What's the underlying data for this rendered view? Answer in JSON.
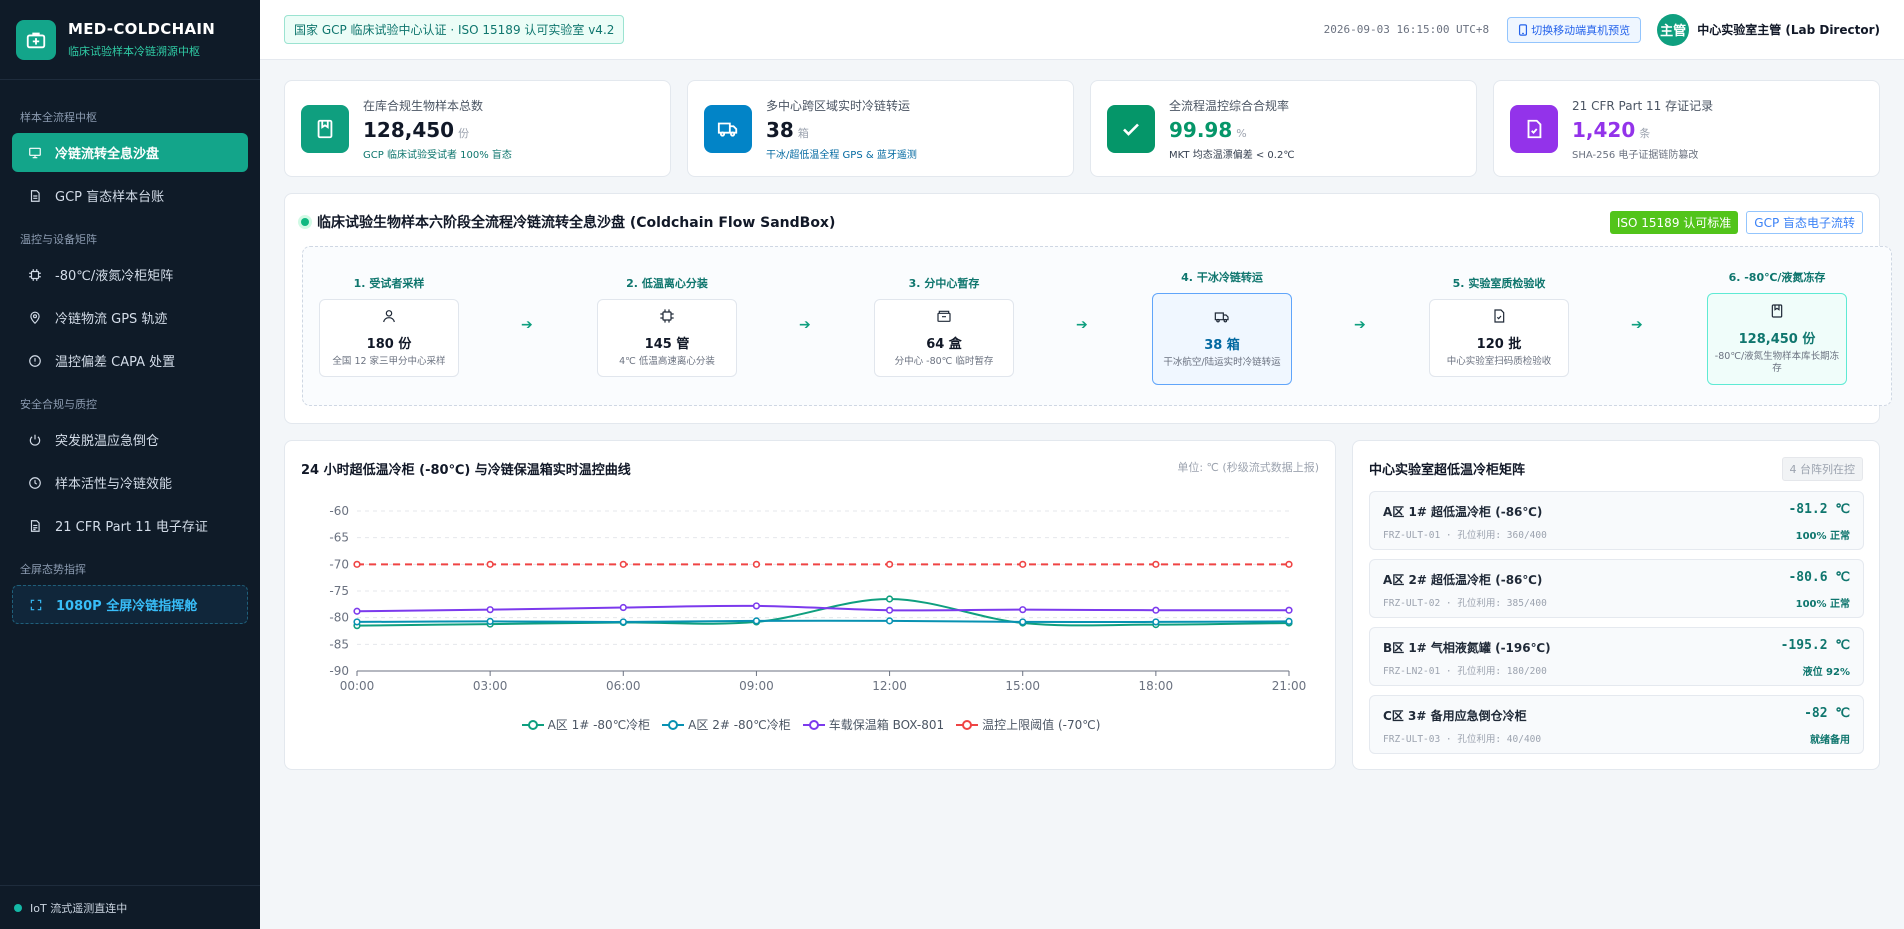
{
  "brand": {
    "title": "MED-COLDCHAIN",
    "subtitle": "临床试验样本冷链溯源中枢"
  },
  "sidebar": {
    "groups": [
      {
        "title": "样本全流程中枢",
        "items": [
          {
            "label": "冷链流转全息沙盘",
            "icon": "monitor-icon",
            "active": true
          },
          {
            "label": "GCP 盲态样本台账",
            "icon": "document-icon"
          }
        ]
      },
      {
        "title": "温控与设备矩阵",
        "items": [
          {
            "label": "-80℃/液氮冷柜矩阵",
            "icon": "chip-icon"
          },
          {
            "label": "冷链物流 GPS 轨迹",
            "icon": "location-pin-icon"
          },
          {
            "label": "温控偏差 CAPA 处置",
            "icon": "alert-circle-icon"
          }
        ]
      },
      {
        "title": "安全合规与质控",
        "items": [
          {
            "label": "突发脱温应急倒仓",
            "icon": "power-icon"
          },
          {
            "label": "样本活性与冷链效能",
            "icon": "clock-icon"
          },
          {
            "label": "21 CFR Part 11 电子存证",
            "icon": "file-text-icon"
          }
        ]
      },
      {
        "title": "全屏态势指挥",
        "items": [
          {
            "label": "1080P 全屏冷链指挥舱",
            "icon": "fullscreen-icon"
          }
        ]
      }
    ],
    "footer": "IoT 流式遥测直连中"
  },
  "header": {
    "cert": "国家 GCP 临床试验中心认证 · ISO 15189 认可实验室 v4.2",
    "timestamp": "2026-09-03 16:15:00 UTC+8",
    "preview_button": "切换移动端真机预览",
    "avatar": "主管",
    "user": "中心实验室主管 (Lab Director)"
  },
  "kpis": [
    {
      "label": "在库合规生物样本总数",
      "value": "128,450",
      "unit": "份",
      "note": "GCP 临床试验受试者 100% 盲态",
      "icon": "storage-box-icon",
      "color": "#0f9f7f",
      "value_color": "#111827",
      "note_color": "#0f766e"
    },
    {
      "label": "多中心跨区域实时冷链转运",
      "value": "38",
      "unit": "箱",
      "note": "干冰/超低温全程 GPS & 蓝牙遥测",
      "icon": "truck-icon",
      "color": "#0284c7",
      "value_color": "#111827",
      "note_color": "#0369a1"
    },
    {
      "label": "全流程温控综合合规率",
      "value": "99.98",
      "unit": "%",
      "note": "MKT 均态温漂偏差 < 0.2℃",
      "icon": "check-icon",
      "color": "#059669",
      "value_color": "#059669",
      "note_color": "#374151"
    },
    {
      "label": "21 CFR Part 11 存证记录",
      "value": "1,420",
      "unit": "条",
      "note": "SHA-256 电子证据链防篡改",
      "icon": "file-check-icon",
      "color": "#9333ea",
      "value_color": "#9333ea",
      "note_color": "#6b7280"
    }
  ],
  "flow": {
    "title": "临床试验生物样本六阶段全流程冷链流转全息沙盘 (Coldchain Flow SandBox)",
    "tag_primary": "ISO 15189 认可标准",
    "tag_secondary": "GCP 盲态电子流转",
    "stages": [
      {
        "label": "1. 受试者采样",
        "value": "180 份",
        "desc": "全国 12 家三甲分中心采样",
        "icon": "user-icon"
      },
      {
        "label": "2. 低温离心分装",
        "value": "145 管",
        "desc": "4℃ 低温高速离心分装",
        "icon": "chip-icon"
      },
      {
        "label": "3. 分中心暂存",
        "value": "64 盒",
        "desc": "分中心 -80℃ 临时暂存",
        "icon": "box-icon"
      },
      {
        "label": "4. 干冰冷链转运",
        "value": "38 箱",
        "desc": "干冰航空/陆运实时冷链转运",
        "icon": "truck-icon"
      },
      {
        "label": "5. 实验室质检验收",
        "value": "120 批",
        "desc": "中心实验室扫码质检验收",
        "icon": "file-check-icon"
      },
      {
        "label": "6. -80℃/液氮冻存",
        "value": "128,450 份",
        "desc": "-80℃/液氮生物样本库长期冻存",
        "icon": "storage-box-icon"
      }
    ]
  },
  "chart_panel": {
    "title": "24 小时超低温冷柜 (-80℃) 与冷链保温箱实时温控曲线",
    "unit_note": "单位: ℃ (秒级流式数据上报)"
  },
  "chart_data": {
    "type": "line",
    "x": [
      "00:00",
      "03:00",
      "06:00",
      "09:00",
      "12:00",
      "15:00",
      "18:00",
      "21:00"
    ],
    "ylim": [
      -90,
      -60
    ],
    "yticks": [
      -60,
      -65,
      -70,
      -75,
      -80,
      -85,
      -90
    ],
    "grid": true,
    "legend_position": "bottom",
    "series": [
      {
        "name": "A区 1# -80℃冷柜",
        "color": "#0f9f7f",
        "values": [
          -81.5,
          -81.2,
          -80.9,
          -80.8,
          -76.5,
          -81.0,
          -81.3,
          -81.0
        ]
      },
      {
        "name": "A区 2# -80℃冷柜",
        "color": "#0891b2",
        "values": [
          -80.8,
          -80.7,
          -80.8,
          -80.6,
          -80.6,
          -80.8,
          -80.8,
          -80.7
        ]
      },
      {
        "name": "车载保温箱 BOX-801",
        "color": "#7c3aed",
        "values": [
          -78.8,
          -78.5,
          -78.1,
          -77.8,
          -78.6,
          -78.5,
          -78.6,
          -78.6
        ]
      },
      {
        "name": "温控上限阈值 (-70℃)",
        "color": "#ef4444",
        "dashed": true,
        "values": [
          -70,
          -70,
          -70,
          -70,
          -70,
          -70,
          -70,
          -70
        ]
      }
    ]
  },
  "matrix": {
    "title": "中心实验室超低温冷柜矩阵",
    "count": "4 台阵列在控",
    "units": [
      {
        "name": "A区 1# 超低温冷柜 (-86℃)",
        "code": "FRZ-ULT-01 · 孔位利用: 360/400",
        "temp": "-81.2 ℃",
        "status": "100% 正常"
      },
      {
        "name": "A区 2# 超低温冷柜 (-86℃)",
        "code": "FRZ-ULT-02 · 孔位利用: 385/400",
        "temp": "-80.6 ℃",
        "status": "100% 正常"
      },
      {
        "name": "B区 1# 气相液氮罐 (-196℃)",
        "code": "FRZ-LN2-01 · 孔位利用: 180/200",
        "temp": "-195.2 ℃",
        "status": "液位 92%"
      },
      {
        "name": "C区 3# 备用应急倒仓冷柜",
        "code": "FRZ-ULT-03 · 孔位利用: 40/400",
        "temp": "-82 ℃",
        "status": "就绪备用"
      }
    ]
  }
}
